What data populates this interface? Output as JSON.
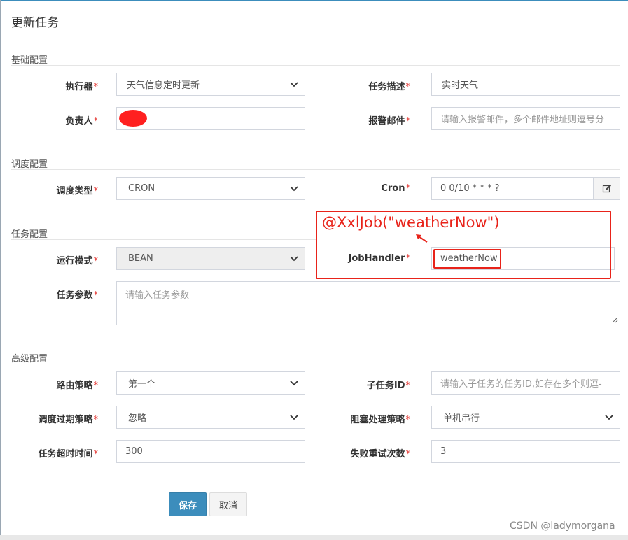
{
  "modal": {
    "title": "更新任务"
  },
  "sections": {
    "basic": "基础配置",
    "schedule": "调度配置",
    "task": "任务配置",
    "advanced": "高级配置"
  },
  "fields": {
    "executor": {
      "label": "执行器",
      "value": "天气信息定时更新"
    },
    "job_desc": {
      "label": "任务描述",
      "value": "实时天气"
    },
    "author": {
      "label": "负责人",
      "value": ""
    },
    "alarm_email": {
      "label": "报警邮件",
      "placeholder": "请输入报警邮件，多个邮件地址则逗号分"
    },
    "schedule_type": {
      "label": "调度类型",
      "value": "CRON"
    },
    "cron": {
      "label": "Cron",
      "value": "0 0/10 * * * ?"
    },
    "run_mode": {
      "label": "运行模式",
      "value": "BEAN"
    },
    "job_handler": {
      "label": "JobHandler",
      "value": "weatherNow"
    },
    "job_param": {
      "label": "任务参数",
      "placeholder": "请输入任务参数"
    },
    "route_strategy": {
      "label": "路由策略",
      "value": "第一个"
    },
    "child_job_id": {
      "label": "子任务ID",
      "placeholder": "请输入子任务的任务ID,如存在多个则逗-"
    },
    "misfire_strategy": {
      "label": "调度过期策略",
      "value": "忽略"
    },
    "block_strategy": {
      "label": "阻塞处理策略",
      "value": "单机串行"
    },
    "timeout": {
      "label": "任务超时时间",
      "value": "300"
    },
    "fail_retry": {
      "label": "失败重试次数",
      "value": "3"
    }
  },
  "required_mark": "*",
  "buttons": {
    "save": "保存",
    "cancel": "取消"
  },
  "annotation": {
    "text": "@XxlJob(\"weatherNow\")",
    "color": "#e8231a"
  },
  "watermark": "CSDN @ladymorgana",
  "icons": {
    "cron_edit": "edit-icon",
    "select": "chevron-down-icon"
  },
  "colors": {
    "primary": "#3c8dbc",
    "required": "#e53935",
    "annotation": "#e8231a"
  }
}
